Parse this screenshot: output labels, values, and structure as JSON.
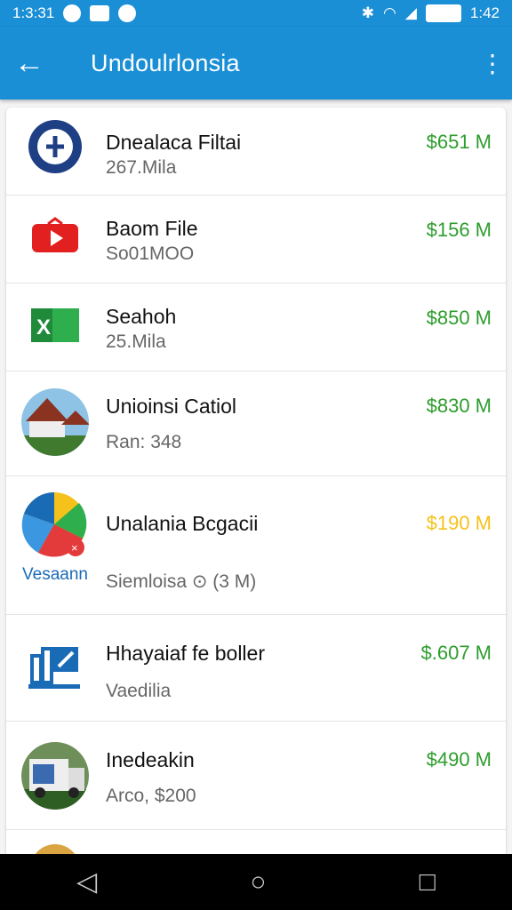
{
  "status": {
    "time": "1:3:31",
    "right": "1:42"
  },
  "appbar": {
    "title": "Undoulrlonsia"
  },
  "items": [
    {
      "name": "Dnealaca Filtai",
      "sub": "267.Mila",
      "price": "$651 M",
      "icon": "globe-icon"
    },
    {
      "name": "Baom File",
      "sub": "So01MOO",
      "price": "$156 M",
      "icon": "play-icon"
    },
    {
      "name": "Seahoh",
      "sub": "25.Mila",
      "price": "$850 M",
      "icon": "spreadsheet-icon"
    },
    {
      "name": "Unioinsi Catiol",
      "sub": "Ran: 348",
      "price": "$830 M",
      "icon": "house-photo-icon"
    },
    {
      "name": "Unalania Bcgacii",
      "sub": "Siemloisa ⊙ (3 M)",
      "price": "$190 M",
      "icon": "colorwheel-icon",
      "badge": "Vesaann",
      "price_color": "yellow"
    },
    {
      "name": "Hhayaiaf fe boller",
      "sub": "Vaedilia",
      "price": "$.607 M",
      "icon": "chart-logo-icon"
    },
    {
      "name": "Inedeakin",
      "sub": "Arco, $200",
      "price": "$490 M",
      "icon": "truck-photo-icon"
    }
  ],
  "nav": {
    "back": "◁",
    "home": "○",
    "recent": "□"
  }
}
